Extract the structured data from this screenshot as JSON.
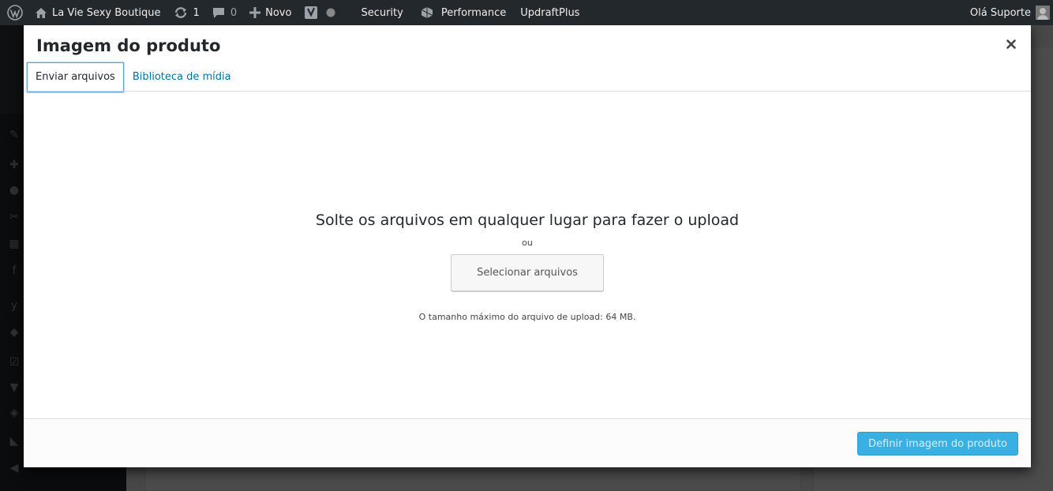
{
  "adminbar": {
    "site_name": "La Vie Sexy Boutique",
    "updates_count": "1",
    "comments_count": "0",
    "new_label": "Novo",
    "security_label": "Security",
    "performance_label": "Performance",
    "updraft_label": "UpdraftPlus",
    "greeting": "Olá Suporte"
  },
  "modal": {
    "title": "Imagem do produto",
    "tabs": [
      {
        "label": "Enviar arquivos",
        "active": true
      },
      {
        "label": "Biblioteca de mídia",
        "active": false
      }
    ],
    "drop_message": "Solte os arquivos em qualquer lugar para fazer o upload",
    "or_text": "ou",
    "select_button": "Selecionar arquivos",
    "max_size_text": "O tamanho máximo do arquivo de upload: 64 MB.",
    "primary_button": "Definir imagem do produto"
  },
  "colors": {
    "adminbar_bg": "#23282d",
    "link": "#0073aa",
    "primary_button": "#3ab0e2"
  }
}
